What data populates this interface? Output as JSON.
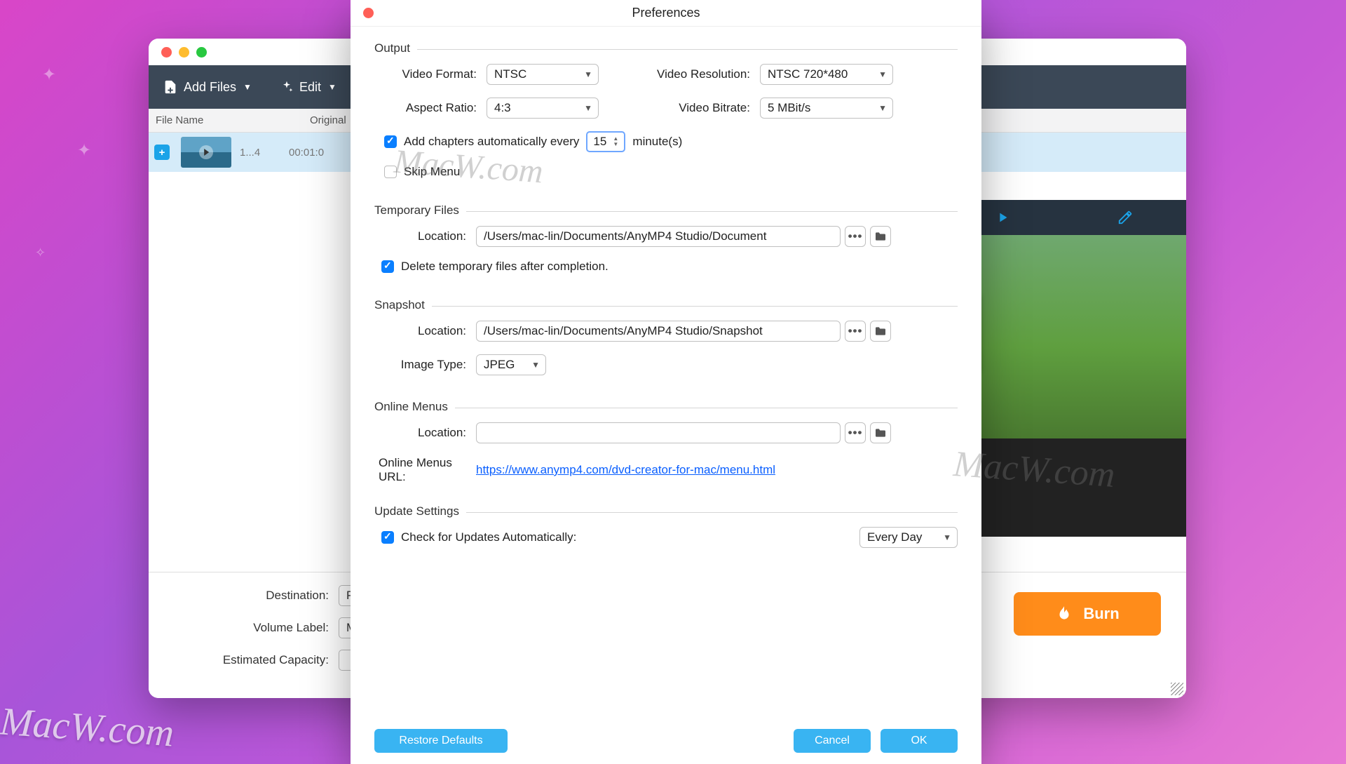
{
  "main_window": {
    "toolbar": {
      "add_files": "Add Files",
      "edit": "Edit"
    },
    "list_header": {
      "file_name": "File Name",
      "original": "Original"
    },
    "file_row": {
      "name": "1...4",
      "time": "00:01:0"
    },
    "bottom": {
      "destination_label": "Destination:",
      "destination_value": "Please s",
      "volume_label": "Volume Label:",
      "volume_value": "My DVD",
      "est_capacity_label": "Estimated Capacity:",
      "burn": "Burn"
    }
  },
  "prefs": {
    "title": "Preferences",
    "output": {
      "legend": "Output",
      "video_format_label": "Video Format:",
      "video_format": "NTSC",
      "aspect_ratio_label": "Aspect Ratio:",
      "aspect_ratio": "4:3",
      "video_resolution_label": "Video Resolution:",
      "video_resolution": "NTSC 720*480",
      "video_bitrate_label": "Video Bitrate:",
      "video_bitrate": "5 MBit/s",
      "add_chapters_label": "Add chapters automatically every",
      "add_chapters_minutes": "15",
      "minute_suffix": "minute(s)",
      "skip_menu": "Skip Menu"
    },
    "temp": {
      "legend": "Temporary Files",
      "location_label": "Location:",
      "location": "/Users/mac-lin/Documents/AnyMP4 Studio/Document",
      "delete_label": "Delete temporary files after completion."
    },
    "snapshot": {
      "legend": "Snapshot",
      "location_label": "Location:",
      "location": "/Users/mac-lin/Documents/AnyMP4 Studio/Snapshot",
      "image_type_label": "Image Type:",
      "image_type": "JPEG"
    },
    "online": {
      "legend": "Online Menus",
      "location_label": "Location:",
      "location": "",
      "url_label": "Online Menus URL:",
      "url": "https://www.anymp4.com/dvd-creator-for-mac/menu.html"
    },
    "update": {
      "legend": "Update Settings",
      "check_label": "Check for Updates Automatically:",
      "freq": "Every Day"
    },
    "buttons": {
      "restore": "Restore Defaults",
      "cancel": "Cancel",
      "ok": "OK"
    }
  },
  "watermark": "MacW.com"
}
